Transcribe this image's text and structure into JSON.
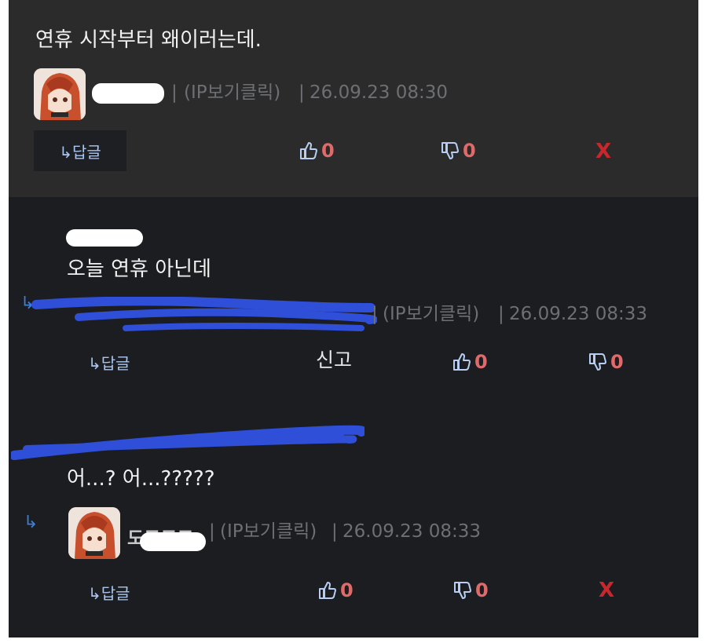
{
  "comments": [
    {
      "text": "연휴 시작부터 왜이러는데.",
      "name_visible": "",
      "separator": "|",
      "ip_label": "(IP보기클릭)",
      "timestamp": "26.09.23 08:30",
      "reply_label": "↳답글",
      "likes": "0",
      "dislikes": "0",
      "delete_label": "X"
    },
    {
      "text": "오늘 연휴 아닌데",
      "ip_label": "(IP보기클릭)",
      "separator": "|",
      "timestamp": "26.09.23 08:33",
      "reply_label": "↳답글",
      "report_label": "신고",
      "likes": "0",
      "dislikes": "0"
    },
    {
      "text": "어...? 어...?????",
      "name_visible": "도트도크",
      "separator": "|",
      "ip_label": "(IP보기클릭)",
      "timestamp": "26.09.23 08:33",
      "reply_label": "↳답글",
      "likes": "0",
      "dislikes": "0",
      "delete_label": "X"
    }
  ],
  "colors": {
    "panel_dark": "#1b1d21",
    "panel_top": "#2b2b2b",
    "vote_count": "#e06a6a",
    "delete": "#c8282d",
    "reply_link": "#a9c6f0",
    "scribble": "#2f4fd8"
  },
  "icons": {
    "like": "thumbs-up-icon",
    "dislike": "thumbs-down-icon",
    "reply_indicator": "reply-arrow-icon"
  }
}
